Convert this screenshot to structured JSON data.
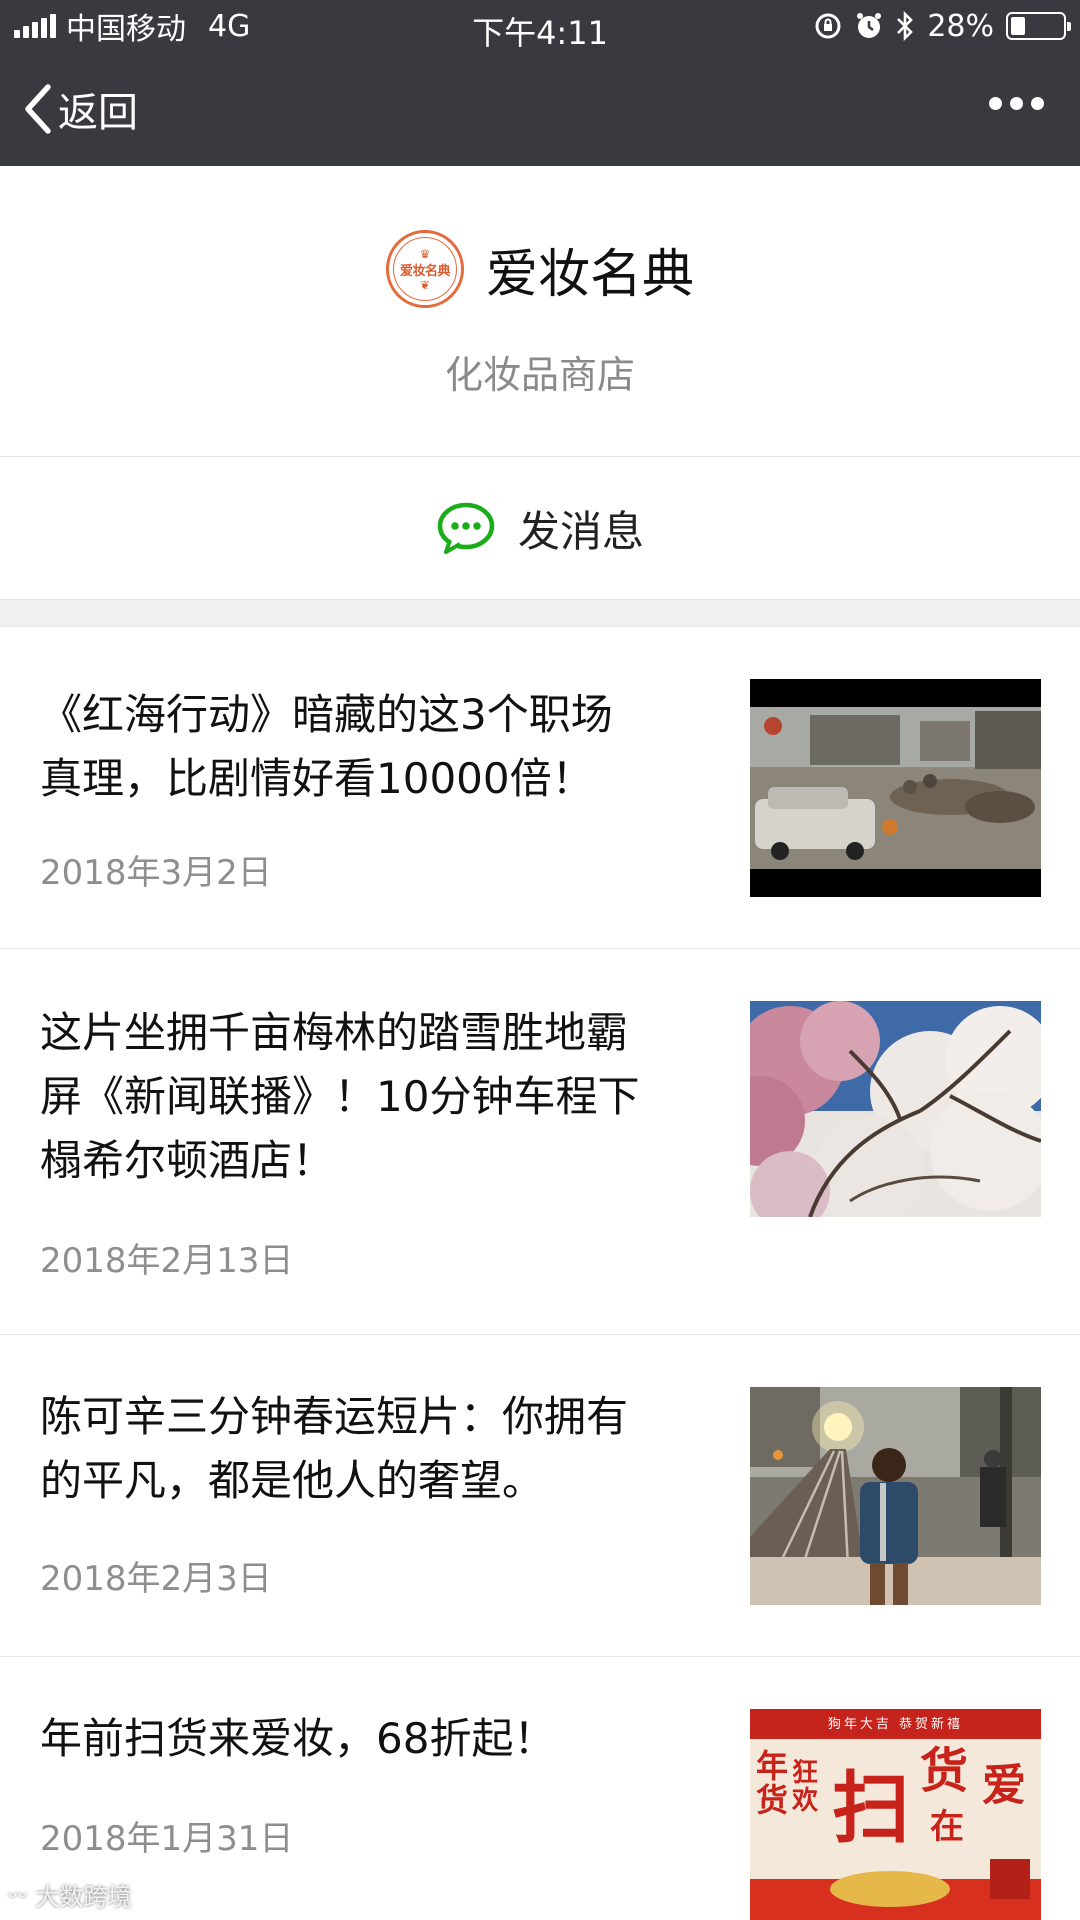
{
  "status_bar": {
    "carrier": "中国移动",
    "network": "4G",
    "time": "下午4:11",
    "battery_text": "28%",
    "battery_level": 0.28
  },
  "nav": {
    "back_label": "返回"
  },
  "profile": {
    "logo_text": "爱妆名典",
    "name": "爱妆名典",
    "type": "化妆品商店"
  },
  "send_message_label": "发消息",
  "articles": [
    {
      "title_lines": [
        "《红海行动》暗藏的这3个职场",
        "真理，比剧情好看10000倍！"
      ],
      "date": "2018年3月2日",
      "thumb": "movie-battle-scene"
    },
    {
      "title_lines": [
        "这片坐拥千亩梅林的踏雪胜地霸",
        "屏《新闻联播》！10分钟车程下",
        "榻希尔顿酒店！"
      ],
      "date": "2018年2月13日",
      "thumb": "plum-blossom-trees"
    },
    {
      "title_lines": [
        "陈可辛三分钟春运短片：你拥有",
        "的平凡，都是他人的奢望。"
      ],
      "date": "2018年2月3日",
      "thumb": "boy-on-railway"
    },
    {
      "title_lines": [
        "年前扫货来爱妆，68折起！"
      ],
      "date": "2018年1月31日",
      "thumb": "new-year-shopping-poster",
      "poster_banner": "狗年大吉 恭贺新禧",
      "poster_text": [
        "年货",
        "狂欢",
        "扫",
        "货",
        "在",
        "爱"
      ]
    }
  ],
  "watermark": "大数跨境",
  "colors": {
    "bar_bg": "#393a3f",
    "wechat_green": "#1aad19",
    "logo_orange": "#e46b3c"
  }
}
